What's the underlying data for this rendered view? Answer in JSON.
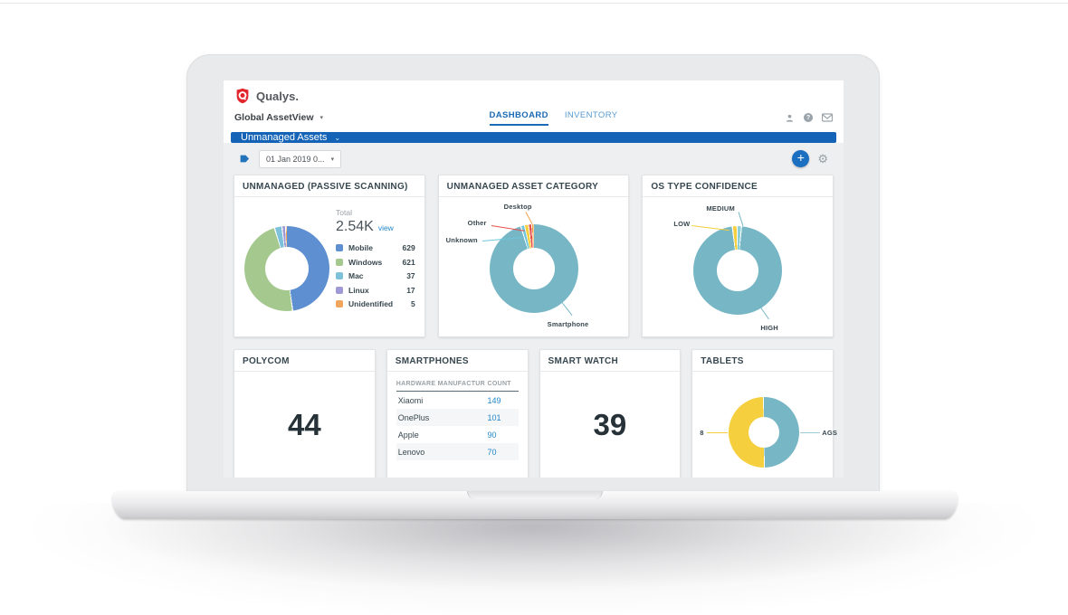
{
  "header": {
    "brand": "Qualys.",
    "context_label": "Global AssetView",
    "tabs": [
      {
        "label": "DASHBOARD",
        "active": true
      },
      {
        "label": "INVENTORY",
        "active": false
      }
    ]
  },
  "toolbar": {
    "dashboard_name": "Unmanaged Assets",
    "date_filter": "01 Jan 2019 0...",
    "add_button": "+"
  },
  "colors": {
    "primary_blue": "#1463b7",
    "link_blue": "#2187c8",
    "teal": "#76b6c5",
    "yellow": "#f5cf3e",
    "brand_red": "#e3262c"
  },
  "chart_data": [
    {
      "type": "donut",
      "title": "UNMANAGED (PASSIVE SCANNING)",
      "total_label": "Total",
      "total": "2.54K",
      "link": "view",
      "legend_position": "right",
      "segments": [
        {
          "label": "Mobile",
          "value": 629,
          "color": "#5d8fd1"
        },
        {
          "label": "Windows",
          "value": 621,
          "color": "#a5c88f"
        },
        {
          "label": "Mac",
          "value": 37,
          "color": "#7ec1db"
        },
        {
          "label": "Linux",
          "value": 17,
          "color": "#9f99d6"
        },
        {
          "label": "Unidentified",
          "value": 5,
          "color": "#f2a55c"
        }
      ]
    },
    {
      "type": "donut",
      "title": "UNMANAGED ASSET CATEGORY",
      "segments": [
        {
          "label": "Smartphone",
          "value": 95.4,
          "color": "#76b6c5"
        },
        {
          "label": "Unknown",
          "value": 1.3,
          "color": "#6ec6dc"
        },
        {
          "label": "Desktop",
          "value": 1.5,
          "color": "#f5cf3e"
        },
        {
          "label": "Other",
          "value": 1.1,
          "color": "#e8504f"
        },
        {
          "label": "",
          "value": 0.7,
          "color": "#f2a146"
        }
      ]
    },
    {
      "type": "donut",
      "title": "OS TYPE CONFIDENCE",
      "segments": [
        {
          "label": "MEDIUM",
          "value": 1.6,
          "color": "#8fd0d8"
        },
        {
          "label": "HIGH",
          "value": 96.7,
          "color": "#76b6c5"
        },
        {
          "label": "LOW",
          "value": 1.7,
          "color": "#f5cf3e"
        }
      ]
    },
    {
      "type": "count",
      "title": "POLYCOM",
      "value": "44"
    },
    {
      "type": "table",
      "title": "SMARTPHONES",
      "columns": [
        "HARDWARE MANUFACTUR",
        "COUNT"
      ],
      "rows": [
        {
          "name": "Xiaomi",
          "count": "149"
        },
        {
          "name": "OnePlus",
          "count": "101"
        },
        {
          "name": "Apple",
          "count": "90"
        },
        {
          "name": "Lenovo",
          "count": "70"
        }
      ]
    },
    {
      "type": "count",
      "title": "SMART WATCH",
      "value": "39"
    },
    {
      "type": "donut",
      "title": "TABLETS",
      "segments": [
        {
          "label": "AGS",
          "value": 50,
          "color": "#76b6c5"
        },
        {
          "label": "8",
          "value": 50,
          "color": "#f5cf3e"
        }
      ]
    }
  ]
}
